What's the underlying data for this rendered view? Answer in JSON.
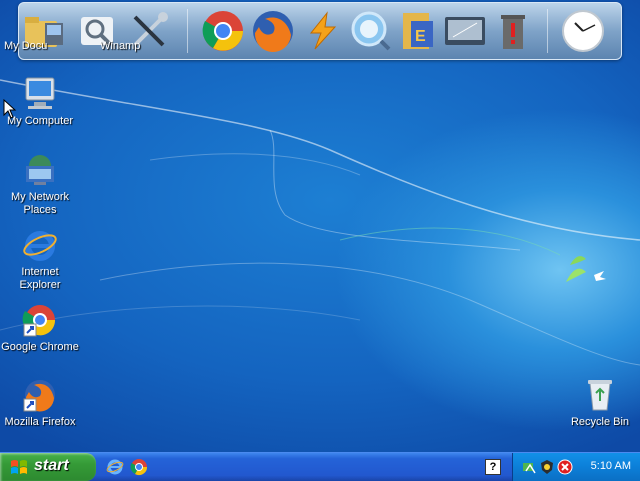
{
  "dock": {
    "partial_label_left": "My Docu",
    "partial_label_winamp": "Winamp",
    "items": [
      "folder-icon",
      "computer-icon",
      "search-icon",
      "tools-icon",
      "chrome-icon",
      "firefox-icon",
      "lightning-icon",
      "search-globe-icon",
      "file-icon",
      "monitor-icon",
      "trash-icon",
      "clock-icon"
    ]
  },
  "desktop_icons": [
    {
      "label": "My Computer",
      "icon": "computer-icon"
    },
    {
      "label": "My Network Places",
      "icon": "network-icon"
    },
    {
      "label": "Internet Explorer",
      "icon": "ie-icon"
    },
    {
      "label": "Google Chrome",
      "icon": "chrome-icon"
    },
    {
      "label": "Mozilla Firefox",
      "icon": "firefox-icon"
    },
    {
      "label": "Recycle Bin",
      "icon": "recycle-bin-icon"
    }
  ],
  "taskbar": {
    "start_label": "start",
    "help_label": "?",
    "clock": "5:10 AM"
  },
  "colors": {
    "start_green": "#359a37",
    "taskbar_blue": "#2258cf",
    "tray_blue": "#0c7fd8"
  }
}
